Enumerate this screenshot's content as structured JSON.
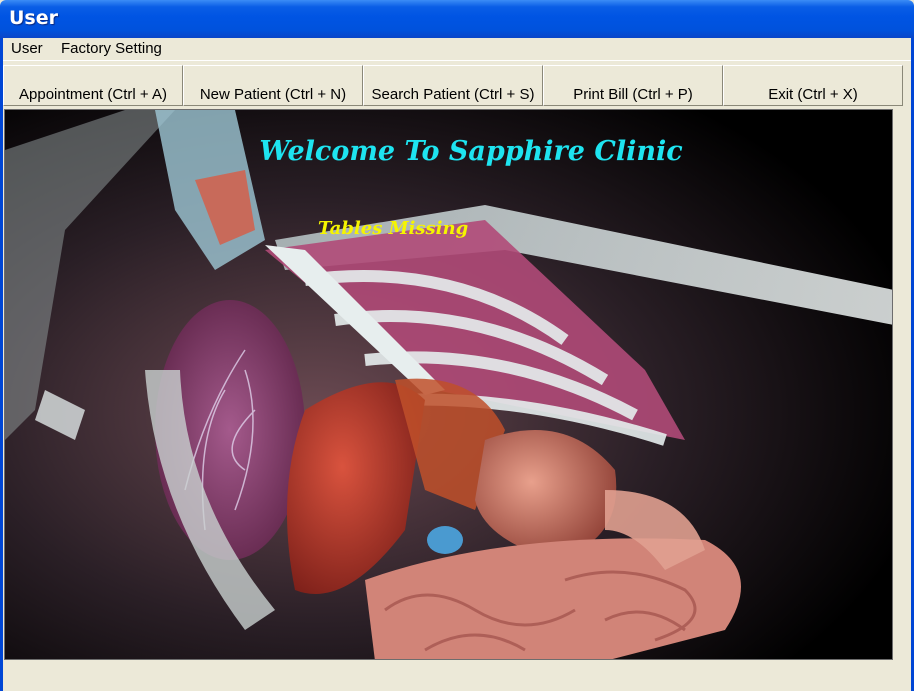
{
  "window": {
    "title": "User"
  },
  "menu": {
    "items": [
      "User",
      "Factory Setting"
    ]
  },
  "toolbar": {
    "buttons": [
      "Appointment (Ctrl + A)",
      "New Patient (Ctrl + N)",
      "Search Patient (Ctrl + S)",
      "Print Bill (Ctrl + P)",
      "Exit (Ctrl + X)"
    ]
  },
  "main": {
    "welcome": "Welcome To Sapphire Clinic",
    "status_message": "Tables Missing"
  },
  "colors": {
    "titlebar": "#0054e3",
    "welcome_text": "#1ee4f0",
    "status_text": "#f5f500",
    "background": "#ece9d8"
  }
}
